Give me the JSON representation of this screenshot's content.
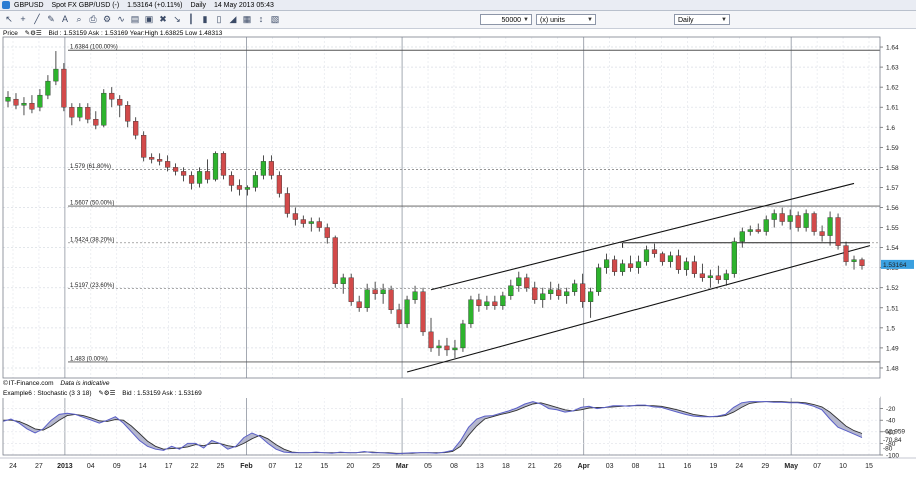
{
  "window": {
    "symbol": "GBPUSD",
    "title_fields": [
      "Spot FX GBP/USD (-)",
      "1.53164 (+0.11%)",
      "Daily",
      "14 May 2013 05:43"
    ]
  },
  "toolbar": {
    "quantity": "50000",
    "units": "(x) units",
    "interval": "Daily",
    "icons": [
      "pointer-icon",
      "crosshair-icon",
      "line-tool-icon",
      "pencil-icon",
      "text-tool-icon",
      "zoom-icon",
      "print-icon",
      "settings-icon",
      "indicator-icon",
      "template-icon",
      "save-icon",
      "delete-icon",
      "line-chart-icon",
      "bar-chart-icon",
      "candle-chart-icon",
      "hollow-candle-icon",
      "area-chart-icon",
      "grid-icon",
      "scale-icon",
      "snapshot-icon"
    ]
  },
  "price_panel": {
    "label": "Price",
    "info": "Bid : 1.53159 Ask : 1.53169 Year:High 1.63825 Low 1.48313",
    "last_price": "1.53164"
  },
  "stoch_panel": {
    "label": "Example6 : Stochastic (3 3 18)",
    "info": "Bid : 1.53159 Ask : 1.53169",
    "readouts": [
      "-62.959",
      "-70.84",
      "-80"
    ]
  },
  "footer": {
    "brand": "IT-Finance.com",
    "disclaimer": "Data is indicative"
  },
  "colors": {
    "bull": "#2db32d",
    "bear": "#d24a4a",
    "stoch_k": "#5a5fc8",
    "stoch_d": "#333333",
    "stoch_fill": "#a8aac6",
    "last_price_bg": "#3aa0e0"
  },
  "chart_data": [
    {
      "type": "candlestick",
      "title": "GBPUSD",
      "ylim": [
        1.475,
        1.645
      ],
      "yticks": [
        "1.64",
        "1.63",
        "1.62",
        "1.61",
        "1.6",
        "1.59",
        "1.58",
        "1.57",
        "1.56",
        "1.55",
        "1.54",
        "1.53",
        "1.52",
        "1.51",
        "1.5",
        "1.49",
        "1.48"
      ],
      "xticks": [
        "24",
        "27",
        "2013",
        "04",
        "09",
        "14",
        "17",
        "22",
        "25",
        "Feb",
        "07",
        "12",
        "15",
        "20",
        "25",
        "Mar",
        "05",
        "08",
        "13",
        "18",
        "21",
        "26",
        "Apr",
        "03",
        "08",
        "11",
        "16",
        "19",
        "24",
        "29",
        "May",
        "07",
        "10",
        "15"
      ],
      "ohlc": [
        [
          1.613,
          1.618,
          1.61,
          1.615
        ],
        [
          1.614,
          1.617,
          1.609,
          1.611
        ],
        [
          1.611,
          1.615,
          1.606,
          1.612
        ],
        [
          1.612,
          1.616,
          1.607,
          1.609
        ],
        [
          1.61,
          1.619,
          1.608,
          1.616
        ],
        [
          1.616,
          1.626,
          1.614,
          1.623
        ],
        [
          1.623,
          1.638,
          1.621,
          1.629
        ],
        [
          1.629,
          1.632,
          1.608,
          1.61
        ],
        [
          1.61,
          1.612,
          1.601,
          1.605
        ],
        [
          1.605,
          1.612,
          1.603,
          1.61
        ],
        [
          1.61,
          1.612,
          1.602,
          1.604
        ],
        [
          1.604,
          1.608,
          1.599,
          1.601
        ],
        [
          1.601,
          1.619,
          1.6,
          1.617
        ],
        [
          1.617,
          1.62,
          1.61,
          1.614
        ],
        [
          1.614,
          1.616,
          1.605,
          1.611
        ],
        [
          1.611,
          1.613,
          1.6,
          1.603
        ],
        [
          1.603,
          1.605,
          1.594,
          1.596
        ],
        [
          1.596,
          1.598,
          1.583,
          1.585
        ],
        [
          1.585,
          1.587,
          1.582,
          1.584
        ],
        [
          1.584,
          1.587,
          1.581,
          1.583
        ],
        [
          1.583,
          1.586,
          1.578,
          1.58
        ],
        [
          1.58,
          1.582,
          1.576,
          1.578
        ],
        [
          1.578,
          1.58,
          1.573,
          1.576
        ],
        [
          1.576,
          1.578,
          1.569,
          1.572
        ],
        [
          1.572,
          1.58,
          1.57,
          1.578
        ],
        [
          1.578,
          1.584,
          1.572,
          1.574
        ],
        [
          1.574,
          1.588,
          1.573,
          1.587
        ],
        [
          1.587,
          1.588,
          1.574,
          1.576
        ],
        [
          1.576,
          1.578,
          1.568,
          1.571
        ],
        [
          1.571,
          1.574,
          1.566,
          1.569
        ],
        [
          1.569,
          1.571,
          1.566,
          1.57
        ],
        [
          1.57,
          1.578,
          1.568,
          1.576
        ],
        [
          1.576,
          1.586,
          1.574,
          1.583
        ],
        [
          1.583,
          1.586,
          1.574,
          1.576
        ],
        [
          1.576,
          1.578,
          1.565,
          1.567
        ],
        [
          1.567,
          1.57,
          1.555,
          1.557
        ],
        [
          1.557,
          1.56,
          1.551,
          1.554
        ],
        [
          1.554,
          1.556,
          1.55,
          1.552
        ],
        [
          1.552,
          1.555,
          1.548,
          1.553
        ],
        [
          1.553,
          1.555,
          1.548,
          1.55
        ],
        [
          1.55,
          1.552,
          1.542,
          1.545
        ],
        [
          1.545,
          1.546,
          1.52,
          1.522
        ],
        [
          1.522,
          1.527,
          1.517,
          1.525
        ],
        [
          1.525,
          1.527,
          1.511,
          1.513
        ],
        [
          1.513,
          1.516,
          1.508,
          1.51
        ],
        [
          1.51,
          1.522,
          1.508,
          1.519
        ],
        [
          1.519,
          1.523,
          1.514,
          1.517
        ],
        [
          1.517,
          1.522,
          1.512,
          1.519
        ],
        [
          1.519,
          1.521,
          1.507,
          1.509
        ],
        [
          1.509,
          1.512,
          1.5,
          1.502
        ],
        [
          1.502,
          1.516,
          1.5,
          1.514
        ],
        [
          1.514,
          1.521,
          1.512,
          1.518
        ],
        [
          1.518,
          1.52,
          1.496,
          1.498
        ],
        [
          1.498,
          1.505,
          1.488,
          1.49
        ],
        [
          1.49,
          1.494,
          1.486,
          1.491
        ],
        [
          1.491,
          1.495,
          1.486,
          1.489
        ],
        [
          1.489,
          1.494,
          1.485,
          1.49
        ],
        [
          1.49,
          1.504,
          1.488,
          1.502
        ],
        [
          1.502,
          1.516,
          1.5,
          1.514
        ],
        [
          1.514,
          1.517,
          1.508,
          1.511
        ],
        [
          1.511,
          1.516,
          1.509,
          1.513
        ],
        [
          1.513,
          1.516,
          1.509,
          1.511
        ],
        [
          1.511,
          1.518,
          1.509,
          1.516
        ],
        [
          1.516,
          1.524,
          1.514,
          1.521
        ],
        [
          1.521,
          1.528,
          1.518,
          1.525
        ],
        [
          1.525,
          1.527,
          1.518,
          1.52
        ],
        [
          1.52,
          1.523,
          1.512,
          1.514
        ],
        [
          1.514,
          1.52,
          1.51,
          1.517
        ],
        [
          1.517,
          1.523,
          1.514,
          1.519
        ],
        [
          1.519,
          1.522,
          1.514,
          1.516
        ],
        [
          1.516,
          1.52,
          1.512,
          1.518
        ],
        [
          1.518,
          1.524,
          1.516,
          1.522
        ],
        [
          1.522,
          1.527,
          1.51,
          1.513
        ],
        [
          1.513,
          1.52,
          1.505,
          1.518
        ],
        [
          1.518,
          1.532,
          1.516,
          1.53
        ],
        [
          1.53,
          1.537,
          1.527,
          1.534
        ],
        [
          1.534,
          1.536,
          1.526,
          1.528
        ],
        [
          1.528,
          1.534,
          1.526,
          1.532
        ],
        [
          1.532,
          1.536,
          1.528,
          1.53
        ],
        [
          1.53,
          1.536,
          1.527,
          1.533
        ],
        [
          1.533,
          1.541,
          1.531,
          1.539
        ],
        [
          1.539,
          1.542,
          1.535,
          1.537
        ],
        [
          1.537,
          1.538,
          1.531,
          1.533
        ],
        [
          1.533,
          1.538,
          1.53,
          1.536
        ],
        [
          1.536,
          1.539,
          1.527,
          1.529
        ],
        [
          1.529,
          1.535,
          1.526,
          1.533
        ],
        [
          1.533,
          1.536,
          1.525,
          1.527
        ],
        [
          1.527,
          1.532,
          1.523,
          1.525
        ],
        [
          1.525,
          1.529,
          1.52,
          1.526
        ],
        [
          1.526,
          1.531,
          1.522,
          1.524
        ],
        [
          1.524,
          1.529,
          1.521,
          1.527
        ],
        [
          1.527,
          1.545,
          1.525,
          1.543
        ],
        [
          1.543,
          1.55,
          1.54,
          1.548
        ],
        [
          1.548,
          1.551,
          1.546,
          1.549
        ],
        [
          1.549,
          1.552,
          1.547,
          1.548
        ],
        [
          1.548,
          1.556,
          1.546,
          1.554
        ],
        [
          1.554,
          1.559,
          1.55,
          1.557
        ],
        [
          1.557,
          1.56,
          1.551,
          1.553
        ],
        [
          1.553,
          1.559,
          1.549,
          1.556
        ],
        [
          1.556,
          1.558,
          1.548,
          1.55
        ],
        [
          1.55,
          1.559,
          1.548,
          1.557
        ],
        [
          1.557,
          1.558,
          1.546,
          1.548
        ],
        [
          1.548,
          1.551,
          1.543,
          1.546
        ],
        [
          1.546,
          1.558,
          1.541,
          1.555
        ],
        [
          1.555,
          1.557,
          1.539,
          1.541
        ],
        [
          1.541,
          1.543,
          1.531,
          1.533
        ],
        [
          1.533,
          1.536,
          1.529,
          1.534
        ],
        [
          1.534,
          1.535,
          1.529,
          1.531
        ]
      ],
      "fibonacci": [
        {
          "label": "1.6384 (100.00%)",
          "value": 1.6384
        },
        {
          "label": "1.579 (61.80%)",
          "value": 1.579
        },
        {
          "label": "1.5607 (50.00%)",
          "value": 1.5607
        },
        {
          "label": "1.5424 (38.20%)",
          "value": 1.5424
        },
        {
          "label": "1.5197 (23.60%)",
          "value": 1.5197
        },
        {
          "label": "1.483 (0.00%)",
          "value": 1.483
        }
      ],
      "channel": {
        "upper": {
          "from": [
            53,
            1.519
          ],
          "to": [
            106,
            1.572
          ]
        },
        "lower": {
          "from": [
            50,
            1.478
          ],
          "to": [
            108,
            1.541
          ]
        }
      },
      "horizontal_levels": [
        {
          "value": 1.5424,
          "from_candle": 77,
          "to_candle": 108
        }
      ]
    },
    {
      "type": "line",
      "title": "Stochastic (3 3 18)",
      "ylim": [
        -100,
        0
      ],
      "yticks": [
        "-20",
        "-40",
        "-60",
        "-80",
        "-100"
      ],
      "series": [
        {
          "name": "%K",
          "values": [
            -42,
            -38,
            -45,
            -55,
            -62,
            -55,
            -40,
            -30,
            -28,
            -30,
            -35,
            -40,
            -45,
            -40,
            -34,
            -45,
            -60,
            -75,
            -85,
            -90,
            -92,
            -85,
            -90,
            -80,
            -80,
            -88,
            -75,
            -80,
            -90,
            -85,
            -70,
            -62,
            -68,
            -80,
            -90,
            -95,
            -96,
            -96,
            -96,
            -95,
            -96,
            -97,
            -95,
            -96,
            -96,
            -94,
            -96,
            -96,
            -97,
            -98,
            -97,
            -96,
            -96,
            -96,
            -97,
            -95,
            -92,
            -75,
            -52,
            -38,
            -33,
            -32,
            -28,
            -24,
            -19,
            -12,
            -8,
            -12,
            -20,
            -22,
            -26,
            -24,
            -18,
            -16,
            -20,
            -18,
            -15,
            -15,
            -16,
            -14,
            -14,
            -17,
            -18,
            -22,
            -26,
            -30,
            -33,
            -34,
            -34,
            -33,
            -30,
            -18,
            -10,
            -8,
            -8,
            -8,
            -9,
            -9,
            -10,
            -10,
            -12,
            -16,
            -22,
            -38,
            -52,
            -58,
            -64,
            -70
          ]
        },
        {
          "name": "%D",
          "values": [
            -40,
            -40,
            -42,
            -48,
            -55,
            -57,
            -50,
            -40,
            -32,
            -30,
            -32,
            -36,
            -41,
            -42,
            -39,
            -40,
            -50,
            -63,
            -76,
            -85,
            -90,
            -89,
            -88,
            -86,
            -82,
            -84,
            -80,
            -80,
            -84,
            -86,
            -80,
            -72,
            -66,
            -72,
            -82,
            -90,
            -95,
            -96,
            -96,
            -96,
            -96,
            -96,
            -96,
            -96,
            -96,
            -95,
            -95,
            -96,
            -96,
            -97,
            -97,
            -97,
            -96,
            -96,
            -96,
            -96,
            -94,
            -85,
            -66,
            -50,
            -38,
            -34,
            -30,
            -27,
            -23,
            -17,
            -12,
            -10,
            -14,
            -18,
            -22,
            -24,
            -22,
            -19,
            -18,
            -18,
            -17,
            -16,
            -15,
            -15,
            -15,
            -15,
            -16,
            -19,
            -22,
            -26,
            -30,
            -32,
            -34,
            -34,
            -32,
            -26,
            -18,
            -11,
            -9,
            -8,
            -8,
            -8,
            -9,
            -9,
            -10,
            -13,
            -17,
            -26,
            -38,
            -50,
            -58,
            -63
          ]
        }
      ]
    }
  ]
}
